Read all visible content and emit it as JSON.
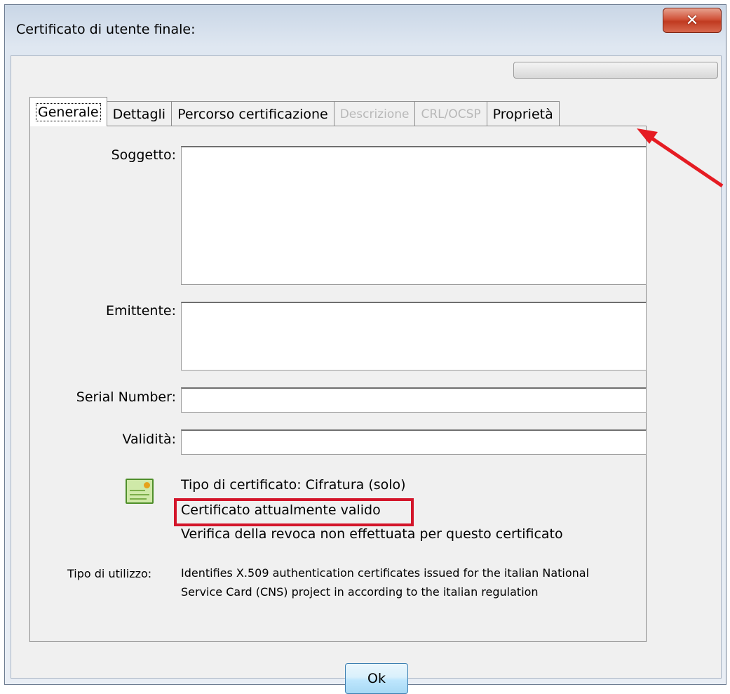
{
  "window": {
    "title": "Certificato di utente finale:"
  },
  "title_bar": {
    "close_icon": "close-x-icon"
  },
  "tabs": [
    {
      "label": "Generale",
      "state": "active"
    },
    {
      "label": "Dettagli",
      "state": "normal"
    },
    {
      "label": "Percorso certificazione",
      "state": "normal"
    },
    {
      "label": "Descrizione",
      "state": "disabled"
    },
    {
      "label": "CRL/OCSP",
      "state": "disabled"
    },
    {
      "label": "Proprietà",
      "state": "normal"
    }
  ],
  "fields": {
    "soggetto_label": "Soggetto:",
    "emittente_label": "Emittente:",
    "serial_label": "Serial Number:",
    "validita_label": "Validità:"
  },
  "status": {
    "icon": "certificate-icon",
    "type_line": "Tipo di certificato: Cifratura (solo)",
    "valid_line": "Certificato attualmente valido",
    "revoke_line": "Verifica della revoca non effettuata per questo certificato"
  },
  "usage": {
    "label": "Tipo di utilizzo:",
    "text": "Identifies X.509 authentication certificates issued for the italian National Service Card (CNS) project in according to the italian regulation"
  },
  "buttons": {
    "ok_label": "Ok"
  },
  "annotations": {
    "highlight_color": "#d3152a"
  }
}
